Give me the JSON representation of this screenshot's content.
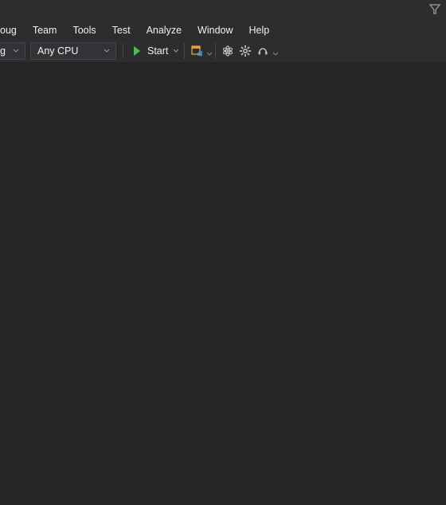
{
  "menubar": {
    "items": [
      {
        "id": "debug",
        "label": "oug"
      },
      {
        "id": "team",
        "label": "Team"
      },
      {
        "id": "tools",
        "label": "Tools"
      },
      {
        "id": "test",
        "label": "Test"
      },
      {
        "id": "analyze",
        "label": "Analyze"
      },
      {
        "id": "window",
        "label": "Window"
      },
      {
        "id": "help",
        "label": "Help"
      }
    ]
  },
  "toolbar": {
    "config_combo": {
      "value": "g"
    },
    "platform_combo": {
      "value": "Any CPU"
    },
    "start_label": "Start"
  }
}
